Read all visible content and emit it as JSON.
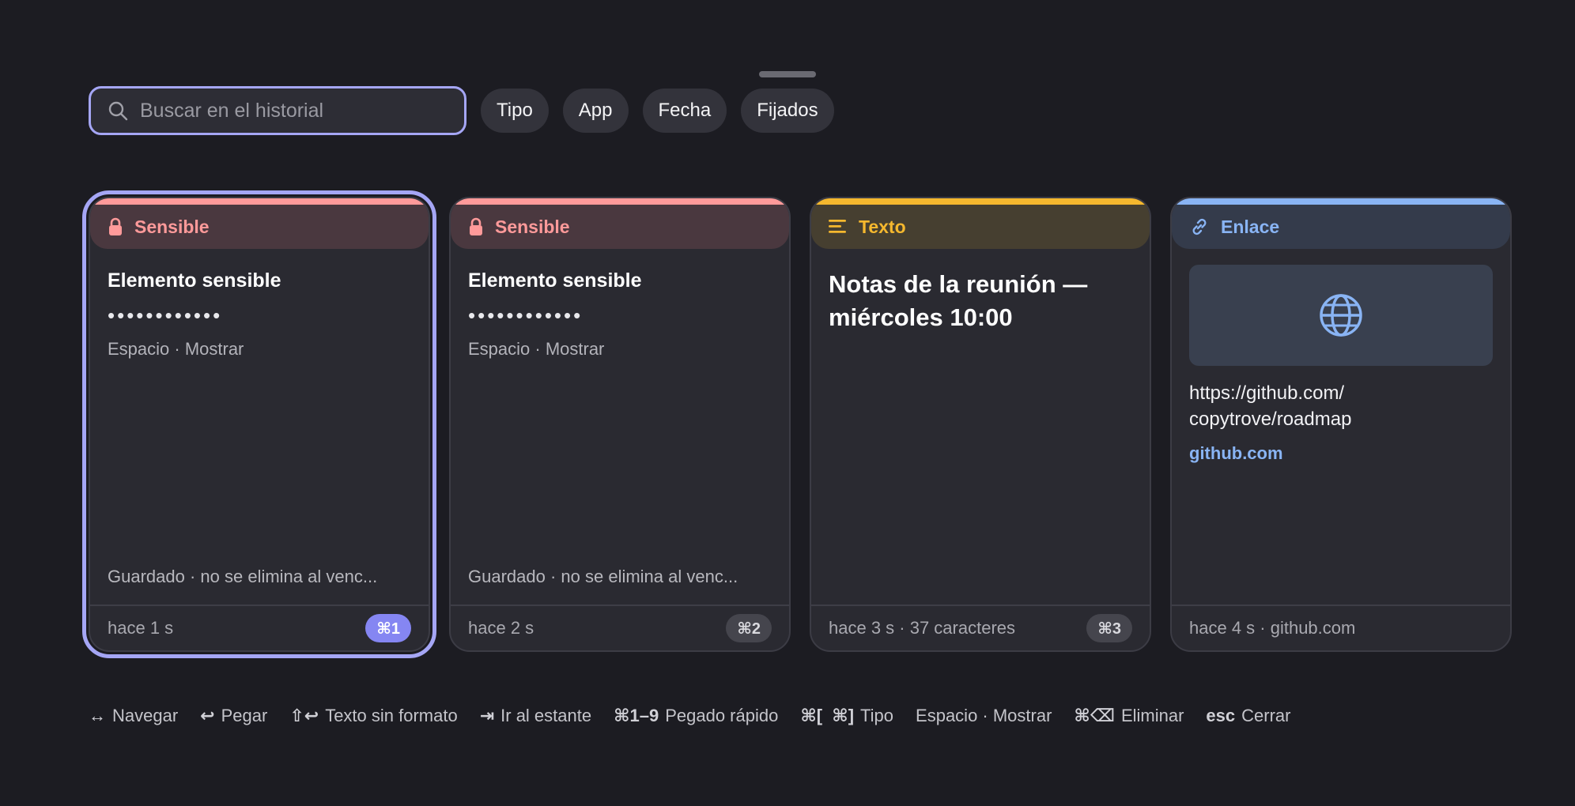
{
  "search": {
    "placeholder": "Buscar en el historial",
    "value": ""
  },
  "filters": [
    "Tipo",
    "App",
    "Fecha",
    "Fijados"
  ],
  "colors": {
    "accent": "#a5a6f5",
    "sensitive": "#ff9a9a",
    "text": "#f5b82e",
    "link": "#89b4f4"
  },
  "cards": [
    {
      "type_label": "Sensible",
      "icon": "lock-icon",
      "title": "Elemento sensible",
      "masked": "••••••••••••",
      "hint": "Espacio · Mostrar",
      "note": "Guardado · no se elimina al venc...",
      "meta": "hace 1 s",
      "shortcut": "⌘1",
      "selected": true
    },
    {
      "type_label": "Sensible",
      "icon": "lock-icon",
      "title": "Elemento sensible",
      "masked": "••••••••••••",
      "hint": "Espacio · Mostrar",
      "note": "Guardado · no se elimina al venc...",
      "meta": "hace 2 s",
      "shortcut": "⌘2",
      "selected": false
    },
    {
      "type_label": "Texto",
      "icon": "text-lines-icon",
      "title": "Notas de la reunión — miércoles 10:00",
      "meta": "hace 3 s · 37 caracteres",
      "shortcut": "⌘3",
      "selected": false
    },
    {
      "type_label": "Enlace",
      "icon": "link-icon",
      "url": "https://github.com/ copytrove/roadmap",
      "domain": "github.com",
      "meta": "hace 4 s · github.com",
      "selected": false
    }
  ],
  "shortcuts": [
    {
      "key": "↔",
      "label": "Navegar"
    },
    {
      "key": "↩",
      "label": "Pegar"
    },
    {
      "key": "⇧↩",
      "label": "Texto sin formato"
    },
    {
      "key": "⇥",
      "label": "Ir al estante"
    },
    {
      "key": "⌘1–9",
      "label": "Pegado rápido"
    },
    {
      "key": "⌘[  ⌘]",
      "label": "Tipo"
    },
    {
      "key": "",
      "label": "Espacio · Mostrar"
    },
    {
      "key": "⌘⌫",
      "label": "Eliminar"
    },
    {
      "key": "esc",
      "label": "Cerrar"
    }
  ]
}
